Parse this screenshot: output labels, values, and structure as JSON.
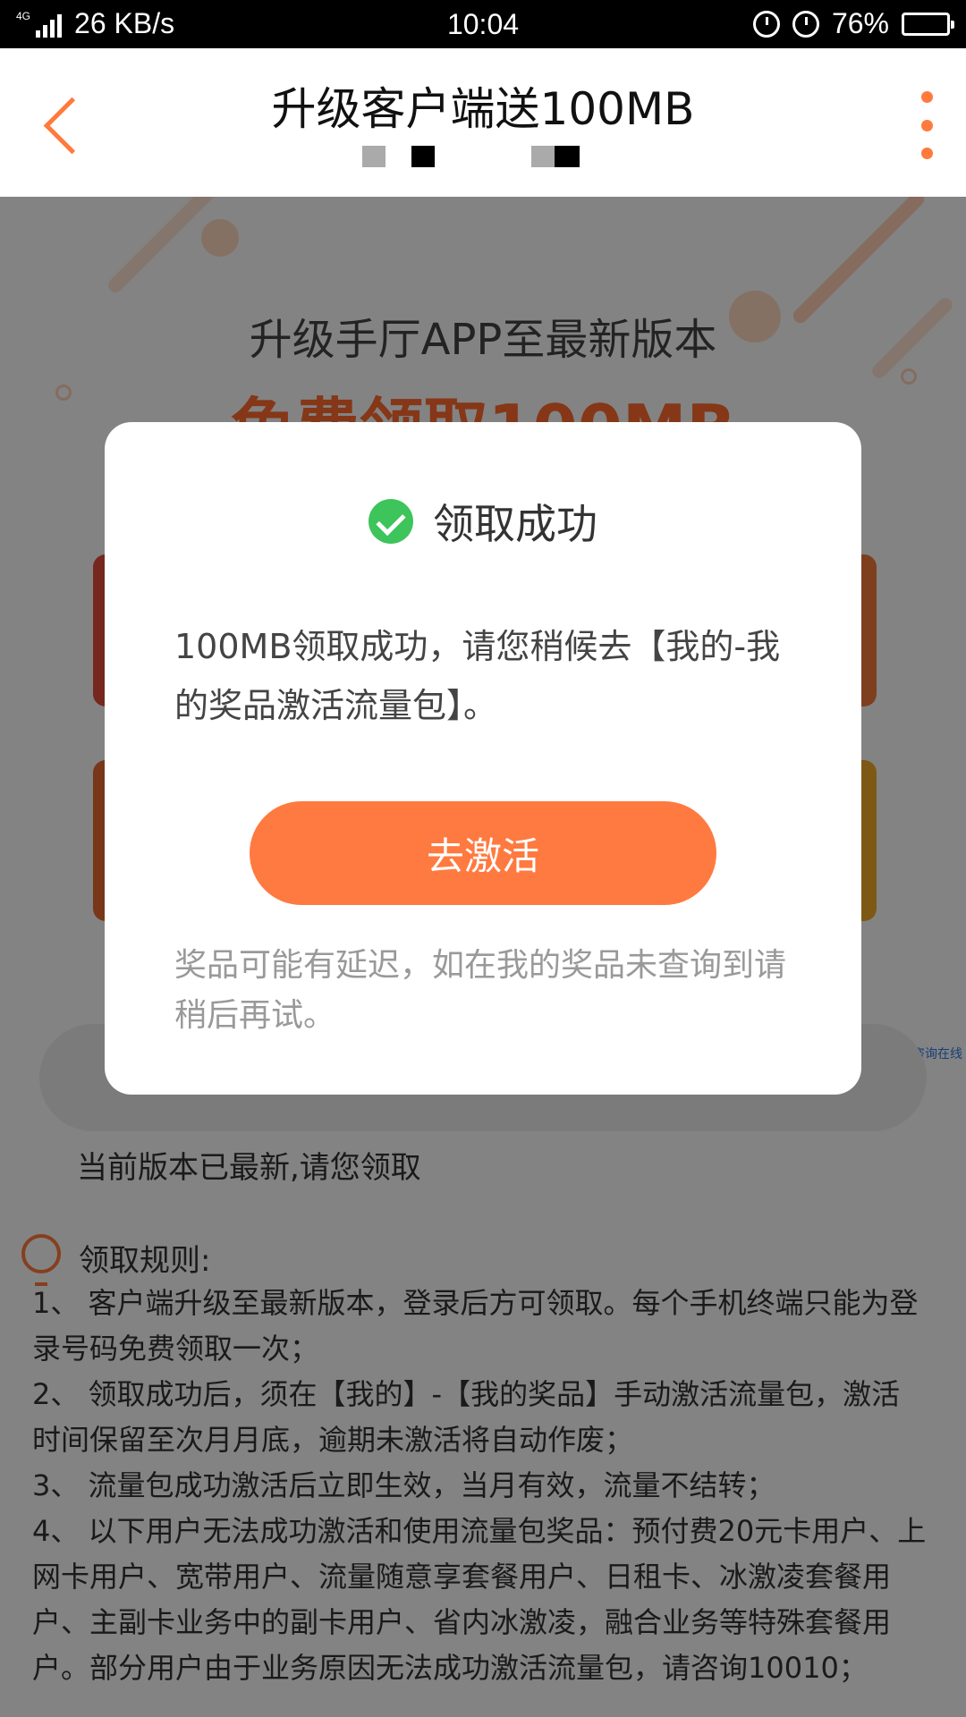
{
  "status_bar": {
    "network": "4G",
    "network2": "4G",
    "speed": "26 KB/s",
    "time": "10:04",
    "battery": "76%"
  },
  "header": {
    "title": "升级客户端送100MB"
  },
  "page": {
    "hero_line1": "升级手厅APP至最新版本",
    "hero_line2": "免费领取100MB",
    "version_status": "当前版本已最新,请您领取",
    "side_link": "咨询在线",
    "rules_title": "领取规则:",
    "rules": [
      "1、 客户端升级至最新版本，登录后方可领取。每个手机终端只能为登",
      "录号码免费领取一次；",
      "2、 领取成功后，须在【我的】-【我的奖品】手动激活流量包，激活",
      "时间保留至次月月底，逾期未激活将自动作废；",
      "3、 流量包成功激活后立即生效，当月有效，流量不结转；",
      "4、 以下用户无法成功激活和使用流量包奖品：预付费20元卡用户、上",
      "网卡用户、宽带用户、流量随意享套餐用户、日租卡、冰激凌套餐用",
      "户、主副卡业务中的副卡用户、省内冰激凌，融合业务等特殊套餐用",
      "户。部分用户由于业务原因无法成功激活流量包，请咨询10010；"
    ]
  },
  "dialog": {
    "title": "领取成功",
    "message": "100MB领取成功，请您稍候去【我的-我的奖品激活流量包】。",
    "button": "去激活",
    "note": "奖品可能有延迟，如在我的奖品未查询到请 稍后再试。"
  },
  "colors": {
    "accent": "#ff7a40",
    "success": "#3dc45a",
    "overlay": "rgba(0,0,0,0.48)"
  },
  "icons": [
    "back-arrow-icon",
    "more-vertical-icon",
    "check-circle-icon",
    "lightbulb-icon",
    "alarm-icon",
    "lock-rotation-icon",
    "battery-icon",
    "signal-icon"
  ]
}
